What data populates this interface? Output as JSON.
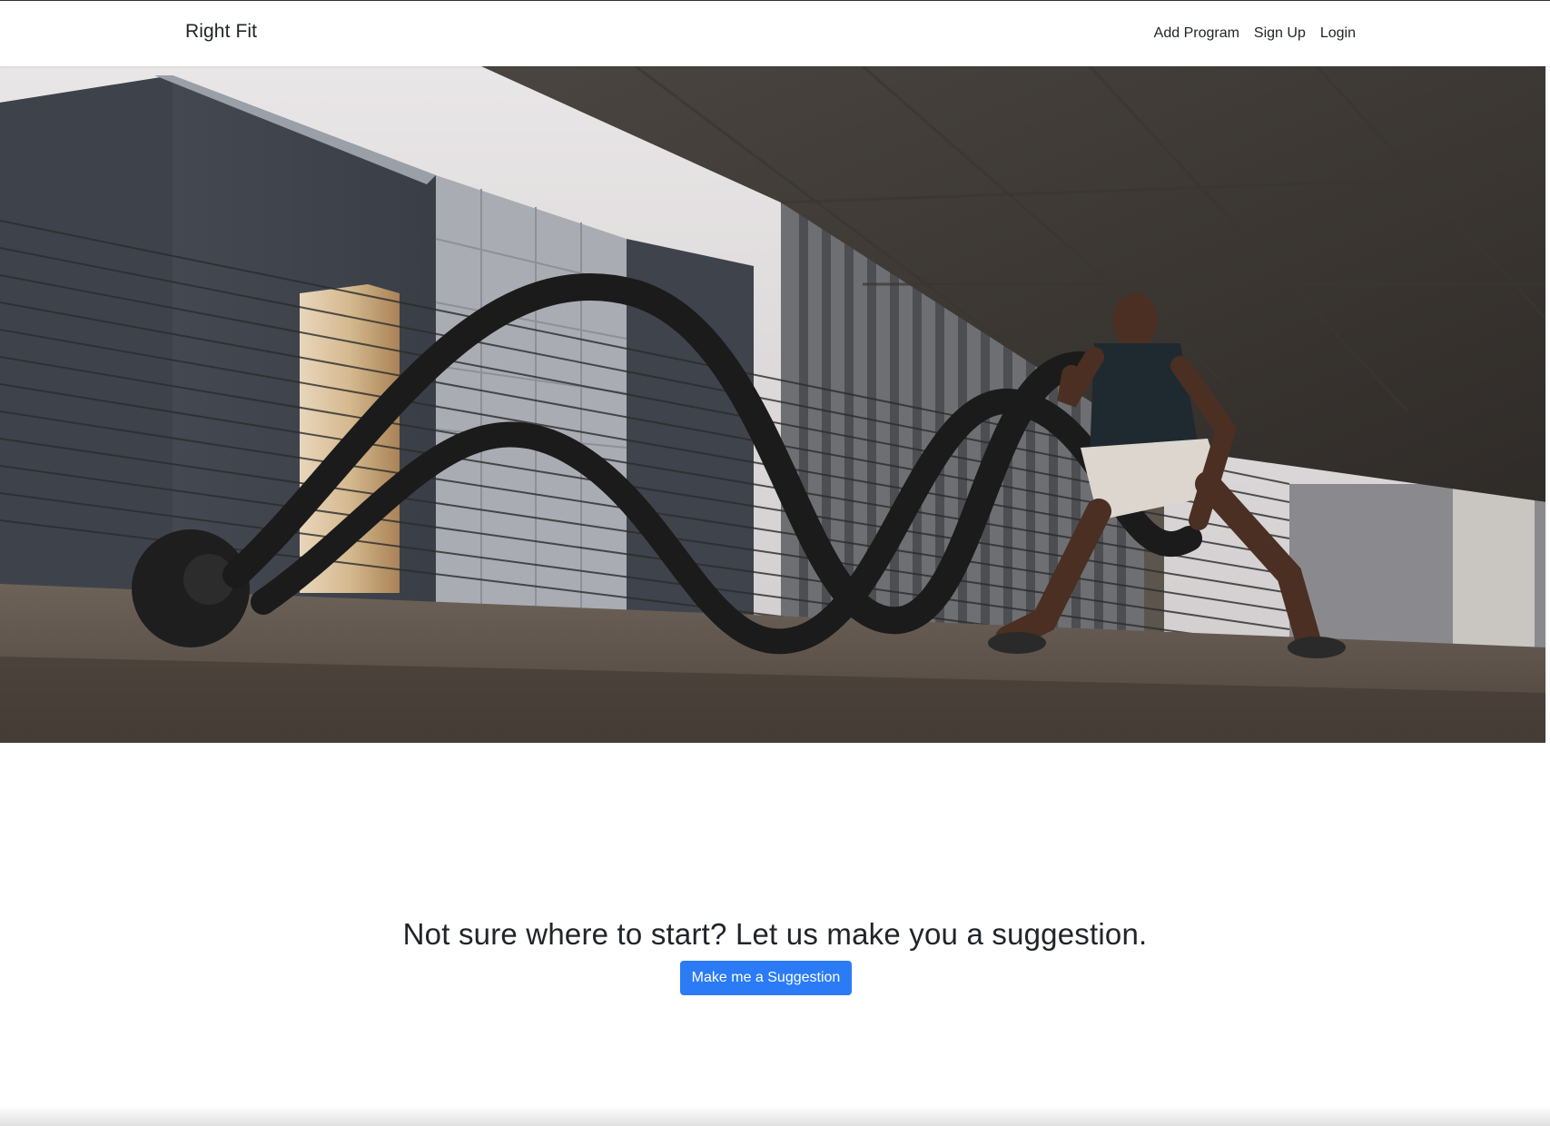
{
  "navbar": {
    "brand": "Right Fit",
    "links": [
      {
        "label": "Add Program"
      },
      {
        "label": "Sign Up"
      },
      {
        "label": "Login"
      }
    ]
  },
  "hero": {
    "image_description_icon": "hero-photo-battle-ropes"
  },
  "cta": {
    "heading": "Not sure where to start? Let us make you a suggestion.",
    "button_label": "Make me a Suggestion"
  },
  "colors": {
    "primary": "#2b7bf6",
    "text": "#212529",
    "background": "#ffffff"
  }
}
